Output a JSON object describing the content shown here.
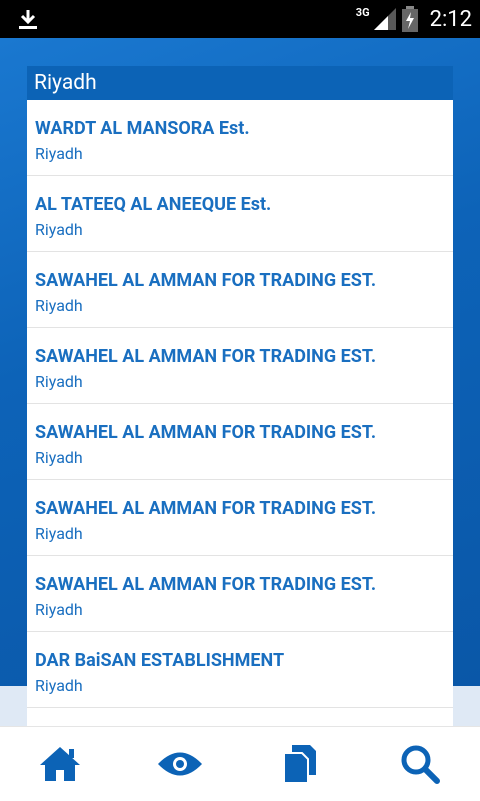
{
  "status_bar": {
    "network": "3G",
    "time": "2:12"
  },
  "panel": {
    "title": "Riyadh",
    "items": [
      {
        "name": "WARDT AL MANSORA Est.",
        "city": "Riyadh"
      },
      {
        "name": "AL TATEEQ AL ANEEQUE Est.",
        "city": "Riyadh"
      },
      {
        "name": "SAWAHEL AL AMMAN FOR TRADING EST.",
        "city": "Riyadh"
      },
      {
        "name": "SAWAHEL AL AMMAN FOR TRADING EST.",
        "city": "Riyadh"
      },
      {
        "name": "SAWAHEL AL AMMAN FOR TRADING EST.",
        "city": "Riyadh"
      },
      {
        "name": "SAWAHEL AL AMMAN FOR TRADING EST.",
        "city": "Riyadh"
      },
      {
        "name": "SAWAHEL AL AMMAN FOR TRADING EST.",
        "city": "Riyadh"
      },
      {
        "name": "DAR BaiSAN ESTABLISHMENT",
        "city": "Riyadh"
      }
    ]
  },
  "bottom_nav": {
    "items": [
      {
        "icon": "home-icon"
      },
      {
        "icon": "eye-icon"
      },
      {
        "icon": "documents-icon"
      },
      {
        "icon": "search-icon"
      }
    ]
  },
  "colors": {
    "accent": "#1a6fc0",
    "header": "#0c63b6",
    "background": "#0b5fb0"
  }
}
